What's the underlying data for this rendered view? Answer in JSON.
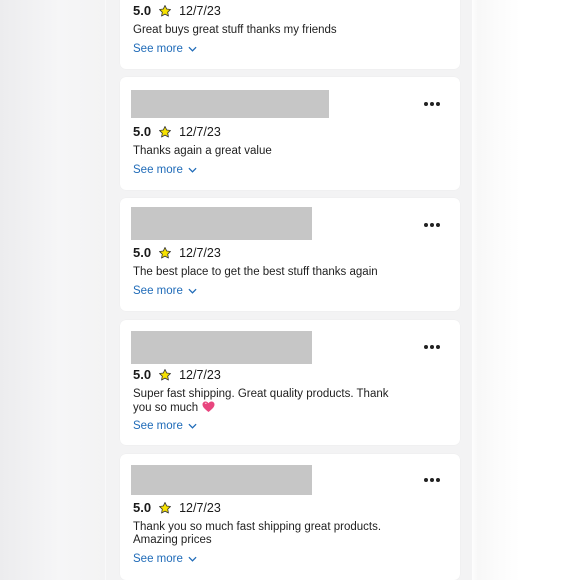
{
  "reviews": [
    {
      "rating": "5.0",
      "date": "12/7/23",
      "text": "Great buys great stuff thanks my friends",
      "emoji": "",
      "see_more": "See more"
    },
    {
      "rating": "5.0",
      "date": "12/7/23",
      "text": "Thanks again a great value",
      "emoji": "",
      "see_more": "See more"
    },
    {
      "rating": "5.0",
      "date": "12/7/23",
      "text": "The best place to get the best stuff thanks again",
      "emoji": "",
      "see_more": "See more"
    },
    {
      "rating": "5.0",
      "date": "12/7/23",
      "text": "Super fast shipping. Great quality products. Thank you so much",
      "emoji": "💖",
      "see_more": "See more"
    },
    {
      "rating": "5.0",
      "date": "12/7/23",
      "text": "Thank you so much fast shipping great products. Amazing prices",
      "emoji": "",
      "see_more": "See more"
    }
  ],
  "icons": {
    "star": "star-icon",
    "more": "more-options-icon",
    "chevron": "chevron-down-icon",
    "heart": "sparkling-heart-emoji"
  },
  "colors": {
    "link": "#1f6bb8",
    "star_fill": "#f7e200",
    "redaction": "#c6c6c6"
  }
}
